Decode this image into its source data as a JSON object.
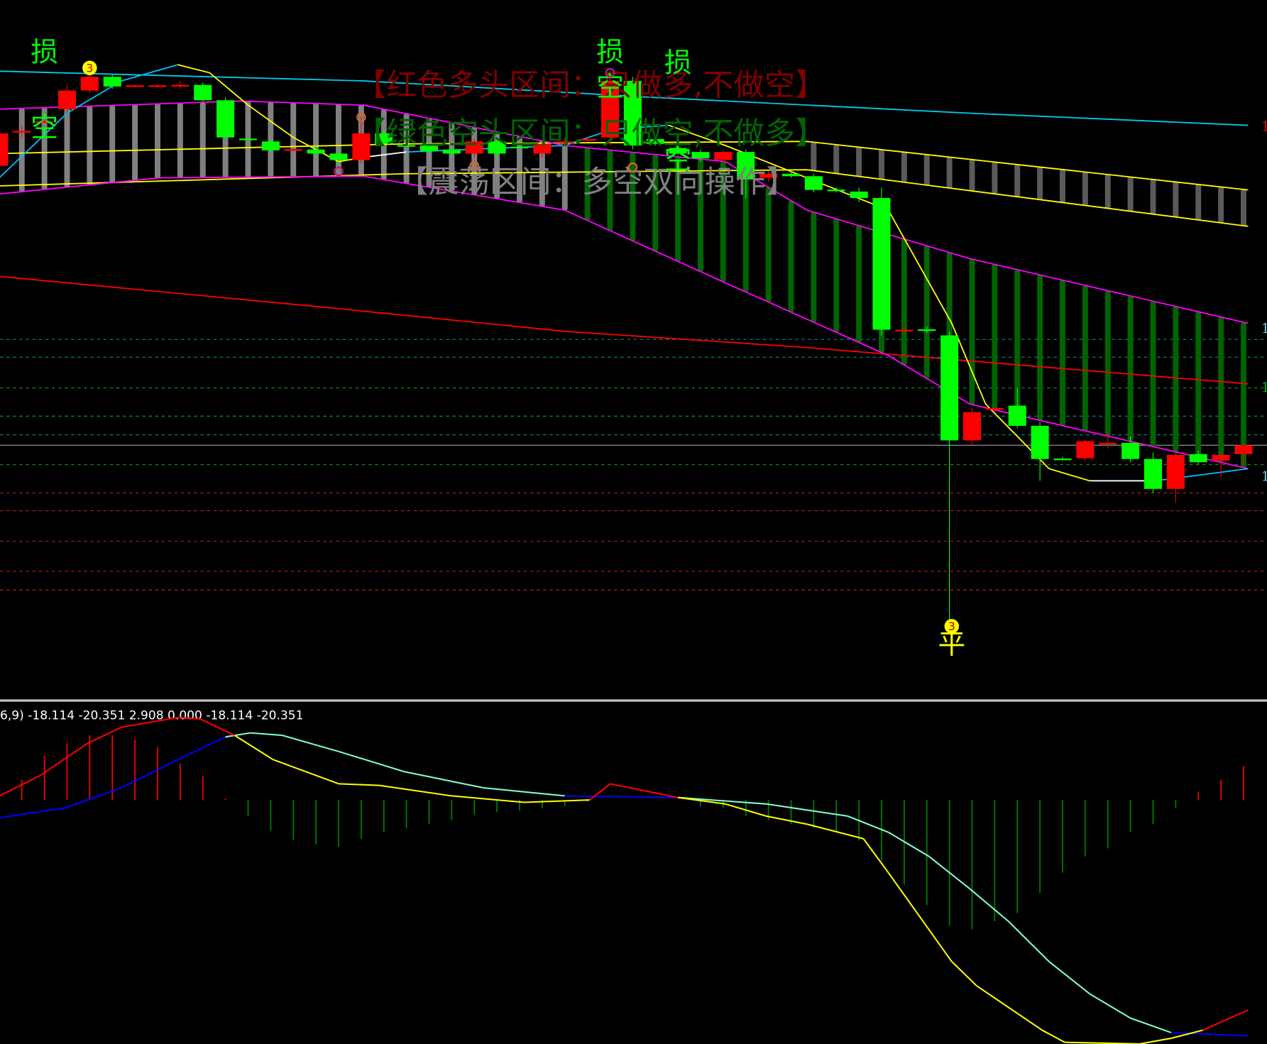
{
  "chart_data": {
    "type": "candlestick",
    "title": "",
    "colors": {
      "up": "#ff0000",
      "down": "#00ff00",
      "bull_band": "#808080",
      "bear_band": "#006400",
      "ma_top": "#00ccee",
      "band_yellow": "#ffff00",
      "band_magenta": "#ff00ff",
      "ma_red": "#ff0000",
      "macd_pos": "#ff0000",
      "macd_neg": "#008000"
    },
    "overlay_texts": [
      {
        "text": "【红色多头区间：只做多,不做空】",
        "color": "#800000"
      },
      {
        "text": "【绿色空头区间：只做空,不做多】",
        "color": "#006400"
      },
      {
        "text": "【震荡区间：多空双向操作】",
        "color": "#808080"
      }
    ],
    "candles": [
      [
        7.95,
        8.4,
        7.9,
        8.35
      ],
      [
        8.38,
        8.45,
        8.3,
        8.38
      ],
      [
        8.5,
        8.52,
        8.48,
        8.5
      ],
      [
        8.65,
        8.95,
        8.6,
        8.88
      ],
      [
        8.88,
        9.1,
        8.85,
        9.05
      ],
      [
        9.05,
        9.08,
        8.9,
        8.93
      ],
      [
        8.94,
        8.96,
        8.92,
        8.945
      ],
      [
        8.94,
        8.96,
        8.92,
        8.945
      ],
      [
        8.95,
        9.0,
        8.9,
        8.95
      ],
      [
        8.95,
        8.98,
        8.74,
        8.76
      ],
      [
        8.76,
        8.8,
        8.28,
        8.3
      ],
      [
        8.285,
        8.3,
        8.26,
        8.28
      ],
      [
        8.25,
        8.27,
        8.12,
        8.14
      ],
      [
        8.15,
        8.17,
        8.13,
        8.155
      ],
      [
        8.15,
        8.2,
        8.05,
        8.1
      ],
      [
        8.1,
        8.14,
        7.95,
        8.02
      ],
      [
        8.02,
        8.55,
        7.98,
        8.35
      ],
      [
        8.35,
        8.4,
        8.2,
        8.22
      ],
      [
        8.205,
        8.25,
        8.18,
        8.2
      ],
      [
        8.2,
        8.24,
        8.1,
        8.13
      ],
      [
        8.15,
        8.18,
        8.05,
        8.1
      ],
      [
        8.1,
        8.28,
        8.05,
        8.25
      ],
      [
        8.25,
        8.3,
        8.05,
        8.1
      ],
      [
        8.185,
        8.22,
        8.15,
        8.18
      ],
      [
        8.1,
        8.25,
        8.05,
        8.22
      ],
      [
        8.245,
        8.3,
        8.2,
        8.25
      ],
      [
        8.275,
        8.3,
        8.25,
        8.28
      ],
      [
        8.3,
        9.12,
        8.2,
        9.0
      ],
      [
        9.0,
        9.05,
        8.15,
        8.2
      ],
      [
        8.28,
        8.32,
        8.2,
        8.22
      ],
      [
        8.17,
        8.2,
        8.08,
        8.1
      ],
      [
        8.12,
        8.15,
        8.0,
        8.04
      ],
      [
        8.02,
        8.15,
        8.0,
        8.12
      ],
      [
        8.12,
        8.15,
        7.55,
        7.78
      ],
      [
        7.8,
        7.88,
        7.75,
        7.85
      ],
      [
        7.85,
        7.88,
        7.8,
        7.82
      ],
      [
        7.82,
        7.85,
        7.62,
        7.65
      ],
      [
        7.655,
        7.68,
        7.62,
        7.65
      ],
      [
        7.63,
        7.68,
        7.5,
        7.55
      ],
      [
        7.55,
        7.68,
        5.85,
        5.92
      ],
      [
        5.915,
        5.96,
        5.88,
        5.92
      ],
      [
        5.925,
        5.96,
        5.88,
        5.92
      ],
      [
        5.85,
        5.9,
        2.25,
        4.55
      ],
      [
        4.55,
        4.95,
        4.5,
        4.9
      ],
      [
        4.945,
        4.98,
        4.9,
        4.95
      ],
      [
        4.98,
        5.2,
        4.7,
        4.73
      ],
      [
        4.73,
        4.78,
        4.05,
        4.32
      ],
      [
        4.325,
        4.35,
        4.3,
        4.32
      ],
      [
        4.33,
        4.56,
        4.3,
        4.54
      ],
      [
        4.515,
        4.65,
        4.45,
        4.52
      ],
      [
        4.52,
        4.6,
        4.28,
        4.32
      ],
      [
        4.32,
        4.4,
        3.9,
        3.95
      ],
      [
        3.95,
        4.4,
        3.78,
        4.37
      ],
      [
        4.38,
        4.42,
        4.25,
        4.28
      ],
      [
        4.3,
        4.4,
        4.1,
        4.37
      ],
      [
        4.38,
        4.52,
        4.25,
        4.49
      ]
    ],
    "lines": {
      "ma_top": [
        [
          0,
          9.12
        ],
        [
          16.1,
          9.0
        ],
        [
          28.6,
          8.8
        ],
        [
          42.9,
          8.6
        ],
        [
          55.2,
          8.45
        ]
      ],
      "yellow_upper": [
        [
          0,
          8.1
        ],
        [
          17.9,
          8.22
        ],
        [
          35.7,
          8.25
        ],
        [
          55.2,
          7.65
        ]
      ],
      "yellow_lower": [
        [
          0,
          7.7
        ],
        [
          17.9,
          7.85
        ],
        [
          35.7,
          7.9
        ],
        [
          55.2,
          7.2
        ]
      ],
      "magenta_upper": [
        [
          0,
          8.65
        ],
        [
          10.7,
          8.75
        ],
        [
          16.1,
          8.7
        ],
        [
          25,
          8.2
        ],
        [
          32.1,
          8.0
        ],
        [
          35.7,
          7.4
        ],
        [
          42.9,
          6.8
        ],
        [
          55.2,
          6.0
        ]
      ],
      "magenta_lower": [
        [
          0,
          7.6
        ],
        [
          7.1,
          7.8
        ],
        [
          16.1,
          7.82
        ],
        [
          25,
          7.4
        ],
        [
          32.1,
          6.5
        ],
        [
          39.3,
          5.6
        ],
        [
          42.9,
          5.0
        ],
        [
          55.2,
          4.2
        ]
      ],
      "ma_red": [
        [
          0,
          6.58
        ],
        [
          14.3,
          6.2
        ],
        [
          25,
          5.9
        ],
        [
          35.7,
          5.7
        ],
        [
          55.2,
          5.25
        ]
      ],
      "fast": [
        {
          "color": "#00bfff",
          "pts": [
            [
              0,
              7.8
            ],
            [
              3,
              8.6
            ],
            [
              5.4,
              9.0
            ],
            [
              7.9,
              9.2
            ]
          ]
        },
        {
          "color": "#ffff00",
          "pts": [
            [
              7.9,
              9.2
            ],
            [
              9.3,
              9.1
            ],
            [
              11,
              8.7
            ],
            [
              13,
              8.3
            ],
            [
              15,
              8.0
            ],
            [
              16,
              8.05
            ]
          ]
        },
        {
          "color": "#ffffff",
          "pts": [
            [
              16,
              8.05
            ],
            [
              18,
              8.12
            ]
          ]
        },
        {
          "color": "#00bfff",
          "pts": [
            [
              18,
              8.12
            ],
            [
              25,
              8.2
            ],
            [
              27.1,
              8.4
            ],
            [
              29.6,
              8.45
            ]
          ]
        },
        {
          "color": "#ffff00",
          "pts": [
            [
              29.6,
              8.45
            ],
            [
              32.1,
              8.2
            ],
            [
              35.7,
              7.8
            ],
            [
              39.3,
              7.4
            ],
            [
              42.1,
              6.0
            ],
            [
              43.6,
              5.0
            ],
            [
              46.4,
              4.2
            ],
            [
              48.2,
              4.05
            ]
          ]
        },
        {
          "color": "#ffffff",
          "pts": [
            [
              48.2,
              4.05
            ],
            [
              51.1,
              4.05
            ]
          ]
        },
        {
          "color": "#00bfff",
          "pts": [
            [
              51.1,
              4.05
            ],
            [
              55.2,
              4.2
            ]
          ]
        }
      ]
    },
    "levels": [
      {
        "price": 5.8,
        "color": "#008b8b",
        "style": "dash"
      },
      {
        "price": 5.58,
        "color": "#008b8b",
        "style": "dash"
      },
      {
        "price": 5.2,
        "color": "#228b22",
        "style": "dash"
      },
      {
        "price": 4.85,
        "color": "#008b8b",
        "style": "dash"
      },
      {
        "price": 4.62,
        "color": "#008b8b",
        "style": "dash"
      },
      {
        "price": 4.49,
        "color": "#a0a0a0",
        "style": "solid"
      },
      {
        "price": 4.25,
        "color": "#228b22",
        "style": "dash"
      },
      {
        "price": 3.9,
        "color": "#b22222",
        "style": "dash"
      },
      {
        "price": 3.68,
        "color": "#b22222",
        "style": "dash"
      },
      {
        "price": 3.3,
        "color": "#b22222",
        "style": "dash"
      },
      {
        "price": 2.93,
        "color": "#b22222",
        "style": "dash"
      },
      {
        "price": 2.7,
        "color": "#b22222",
        "style": "dash"
      }
    ],
    "markers": [
      {
        "text": "损",
        "i": 2,
        "p": 9.38,
        "color": "#00ff00"
      },
      {
        "text": "空",
        "i": 2,
        "p": 8.45,
        "color": "#00ff00"
      },
      {
        "text": "损",
        "i": 27,
        "p": 9.38,
        "color": "#00ff00"
      },
      {
        "text": "空",
        "i": 27,
        "p": 8.95,
        "color": "#00ff00"
      },
      {
        "text": "损",
        "i": 30,
        "p": 9.25,
        "color": "#00ff00"
      },
      {
        "text": "空",
        "i": 30,
        "p": 8.05,
        "color": "#00ff00"
      },
      {
        "text": "3",
        "i": 4,
        "p": 9.16,
        "color": "#ffff00",
        "circle": true
      },
      {
        "text": "3",
        "i": 42.1,
        "p": 2.25,
        "color": "#ffff00",
        "circle": true
      },
      {
        "text": "平",
        "i": 42.1,
        "p": 2.05,
        "color": "#ffff00"
      }
    ],
    "right_axis_labels": [
      {
        "text": "1",
        "p": 8.38,
        "color": "#ff0000"
      },
      {
        "text": "1",
        "p": 5.88,
        "color": "#87ceeb"
      },
      {
        "text": "1",
        "p": 5.15,
        "color": "#00c000"
      },
      {
        "text": "1",
        "p": 4.05,
        "color": "#87ceeb"
      }
    ],
    "macd": {
      "header": "6,9) -18.114 -20.351 2.908 0.000 -18.114 -20.351",
      "hist": [
        0,
        2.5,
        5.5,
        7,
        8,
        8,
        7.5,
        6.5,
        4.5,
        3,
        0.2,
        -2,
        -3.8,
        -5,
        -5.5,
        -5.8,
        -4.8,
        -4,
        -3.5,
        -3,
        -2.5,
        -1.8,
        -1.5,
        -1.3,
        -1,
        -0.8,
        -0.2,
        0,
        0,
        0,
        0,
        -0.8,
        -1,
        -2,
        -2.5,
        -3,
        -3.5,
        -4,
        -5,
        -7.5,
        -10.5,
        -13,
        -15.5,
        -16,
        -15,
        -14,
        -11.5,
        -9,
        -7,
        -6,
        -4,
        -3,
        -1,
        1,
        2.5,
        4.2
      ],
      "dif": [
        [
          0,
          0.5
        ],
        [
          1.8,
          3
        ],
        [
          3.9,
          7
        ],
        [
          5.4,
          9
        ],
        [
          7.9,
          10.2
        ],
        [
          8.9,
          10
        ],
        [
          10.4,
          8
        ],
        [
          12.1,
          5
        ],
        [
          15,
          2
        ],
        [
          16.8,
          1.8
        ],
        [
          20,
          0.5
        ],
        [
          23.2,
          -0.3
        ],
        [
          26.1,
          0
        ],
        [
          27,
          2
        ],
        [
          30,
          0.3
        ],
        [
          32.1,
          -0.5
        ],
        [
          33.9,
          -2
        ],
        [
          35.7,
          -3
        ],
        [
          38.2,
          -4.8
        ],
        [
          39.3,
          -9
        ],
        [
          42.1,
          -20
        ],
        [
          43.2,
          -23
        ],
        [
          46.1,
          -28.5
        ],
        [
          47.1,
          -30
        ],
        [
          50.4,
          -30.2
        ],
        [
          51.8,
          -29.5
        ],
        [
          53.2,
          -28.5
        ],
        [
          55.2,
          -26
        ]
      ],
      "dea": [
        [
          0,
          -2.2
        ],
        [
          2.9,
          -1
        ],
        [
          5.4,
          1.5
        ],
        [
          7.9,
          5
        ],
        [
          10,
          7.8
        ],
        [
          11.1,
          8.3
        ],
        [
          12.5,
          8
        ],
        [
          15,
          6
        ],
        [
          17.9,
          3.5
        ],
        [
          21.4,
          1.5
        ],
        [
          25,
          0.5
        ],
        [
          30,
          0.3
        ],
        [
          33.9,
          -0.5
        ],
        [
          37.5,
          -2
        ],
        [
          39.3,
          -4
        ],
        [
          41.1,
          -7
        ],
        [
          42.9,
          -11
        ],
        [
          44.6,
          -15
        ],
        [
          46.4,
          -20
        ],
        [
          48.2,
          -24
        ],
        [
          50,
          -27
        ],
        [
          51.8,
          -28.8
        ],
        [
          55.2,
          -29.2
        ]
      ]
    }
  }
}
